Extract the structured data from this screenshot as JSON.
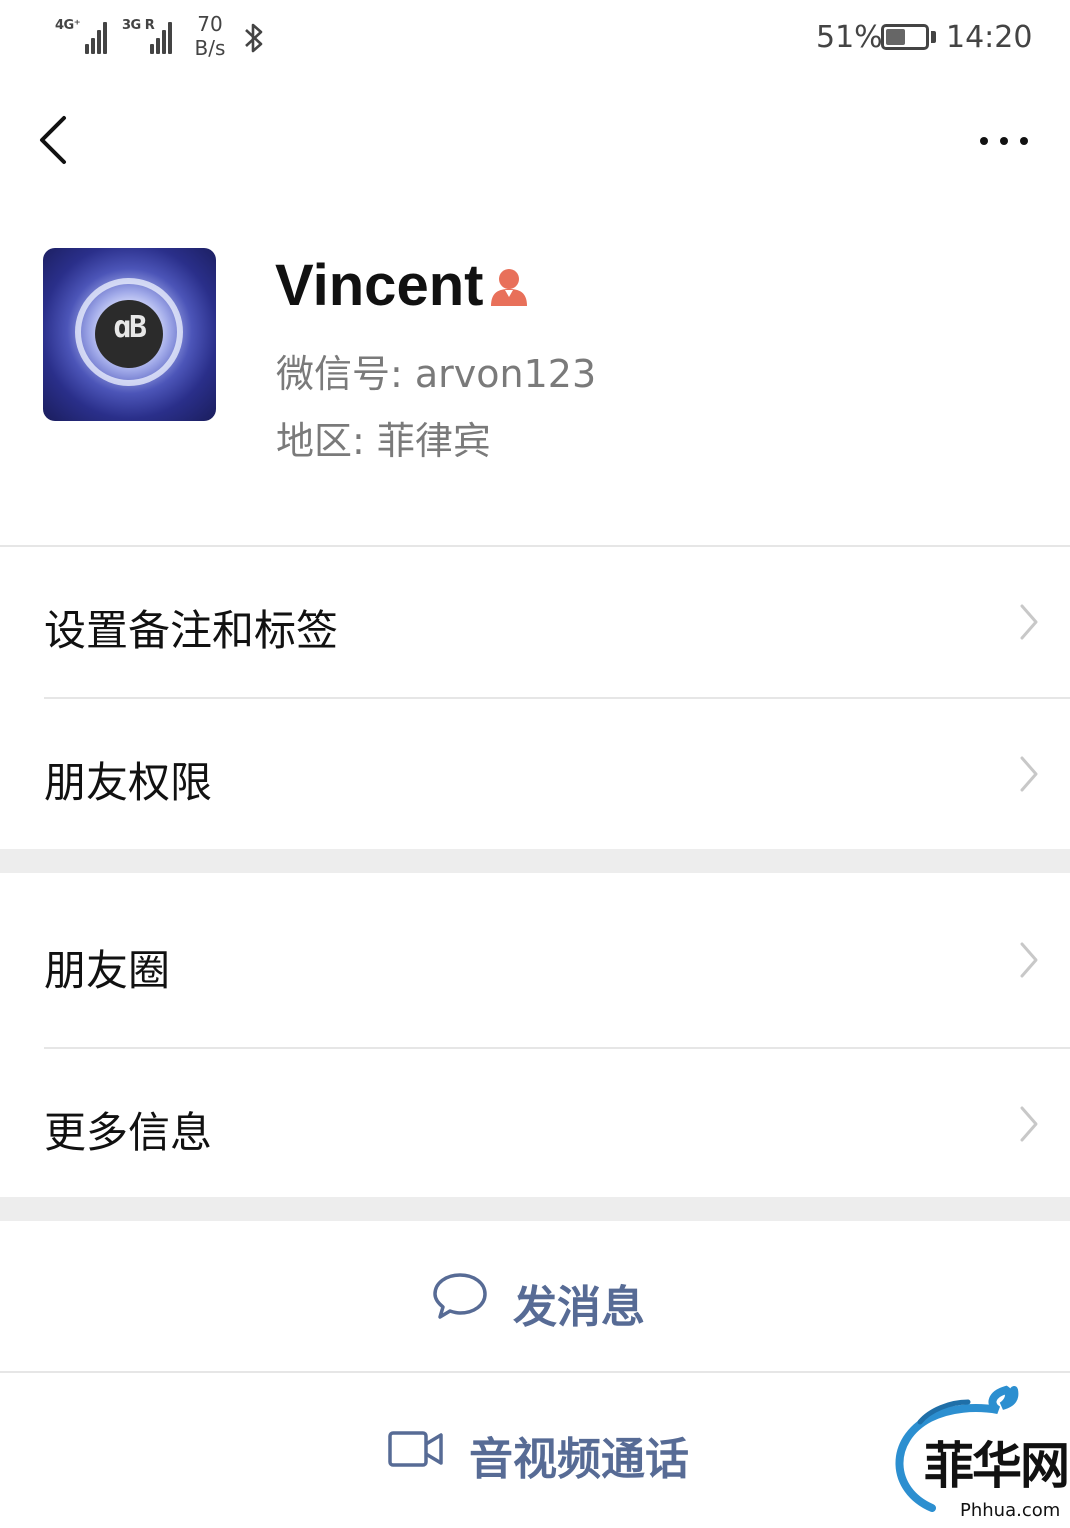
{
  "status_bar": {
    "network_1": "4G⁺",
    "network_2": "3G R",
    "speed_value": "70",
    "speed_unit": "B/s",
    "bluetooth_icon": "bluetooth-icon",
    "battery_percent": "51%",
    "battery_level": 0.51,
    "time": "14:20"
  },
  "nav": {
    "back_icon": "chevron-left-icon",
    "more_icon": "more-dots-icon"
  },
  "profile": {
    "name": "Vincent",
    "gender_icon": "person-icon",
    "gender_icon_color": "#e8705a",
    "wechat_id_label": "微信号: arvon123",
    "region_label": "地区: 菲律宾"
  },
  "menu": {
    "items": [
      {
        "label": "设置备注和标签"
      },
      {
        "label": "朋友权限"
      },
      {
        "label": "朋友圈"
      },
      {
        "label": "更多信息"
      }
    ]
  },
  "actions": {
    "message_label": "发消息",
    "message_icon": "chat-bubble-icon",
    "call_label": "音视频通话",
    "call_icon": "video-camera-icon",
    "accent_color": "#576b95"
  },
  "watermark": {
    "logo_text": "菲华网",
    "domain": "Phhua.com"
  }
}
